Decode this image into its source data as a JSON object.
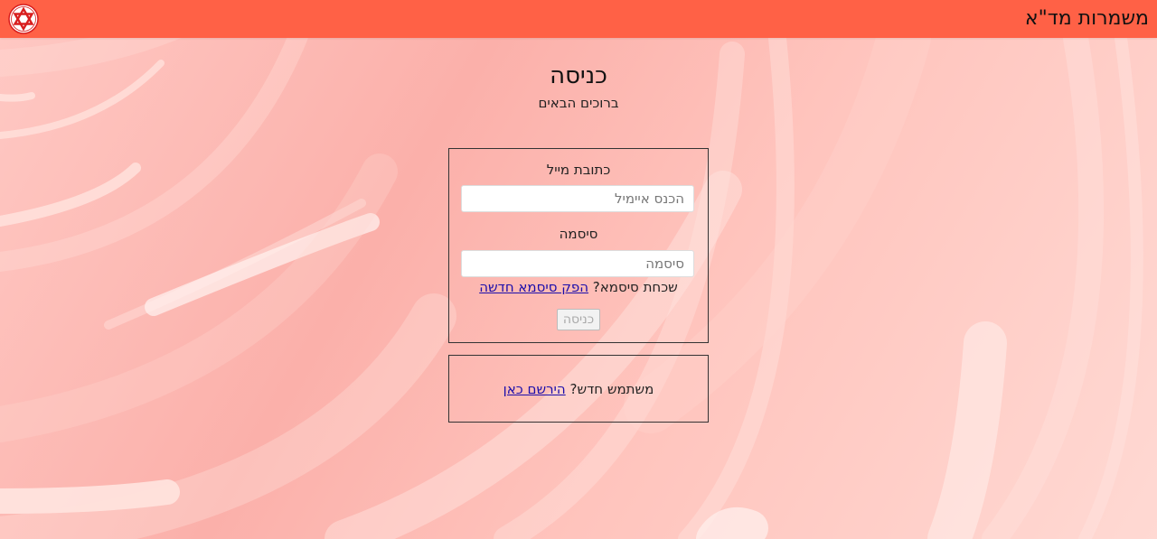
{
  "header": {
    "app_title": "משמרות מד\"א"
  },
  "page": {
    "title": "כניסה",
    "subtitle": "ברוכים הבאים"
  },
  "login_form": {
    "email_label": "כתובת מייל",
    "email_placeholder": "הכנס איימיל",
    "email_value": "",
    "password_label": "סיסמה",
    "password_placeholder": "סיסמה",
    "password_value": "",
    "forgot_text": "שכחת סיסמא?",
    "forgot_link": "הפק סיסמא חדשה",
    "submit_label": "כניסה"
  },
  "register": {
    "text": "משתמש חדש?",
    "link": "הירשם כאן"
  },
  "colors": {
    "header_bg": "#ff6146",
    "logo_red": "#d81e1e",
    "link": "#1a0dab"
  },
  "icons": {
    "logo": "magen-david-adom-logo"
  }
}
